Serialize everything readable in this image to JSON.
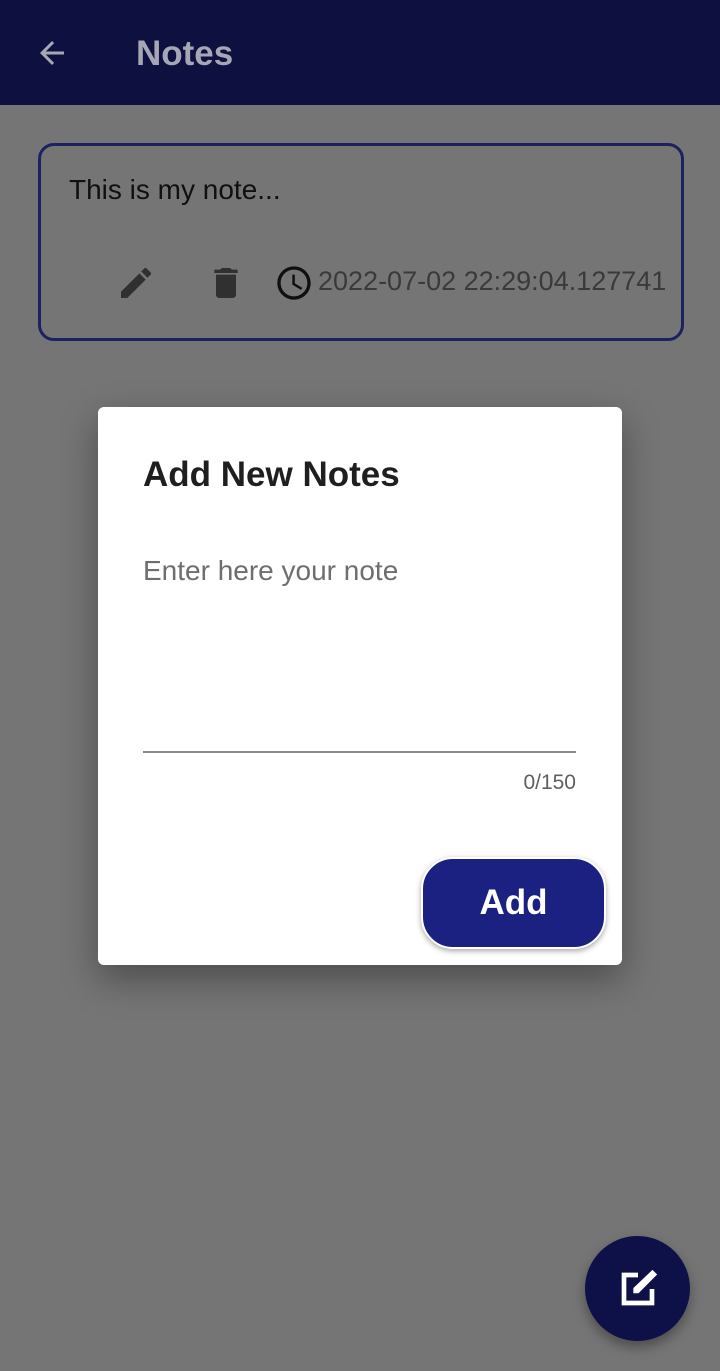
{
  "app_bar": {
    "title": "Notes",
    "back_icon": "arrow-back-icon"
  },
  "notes": [
    {
      "text": "This is my note...",
      "timestamp": "2022-07-02 22:29:04.127741",
      "edit_icon": "pencil-icon",
      "delete_icon": "trash-icon",
      "clock_icon": "clock-icon"
    }
  ],
  "dialog": {
    "title": "Add New Notes",
    "input": {
      "value": "",
      "placeholder": "Enter here your note"
    },
    "counter": "0/150",
    "add_label": "Add"
  },
  "fab": {
    "icon": "edit-note-icon"
  },
  "colors": {
    "app_bar": "#0e1040",
    "accent": "#1b2180",
    "scrim": "#757575",
    "card_border": "#1c2260",
    "dialog_bg": "#ffffff"
  }
}
